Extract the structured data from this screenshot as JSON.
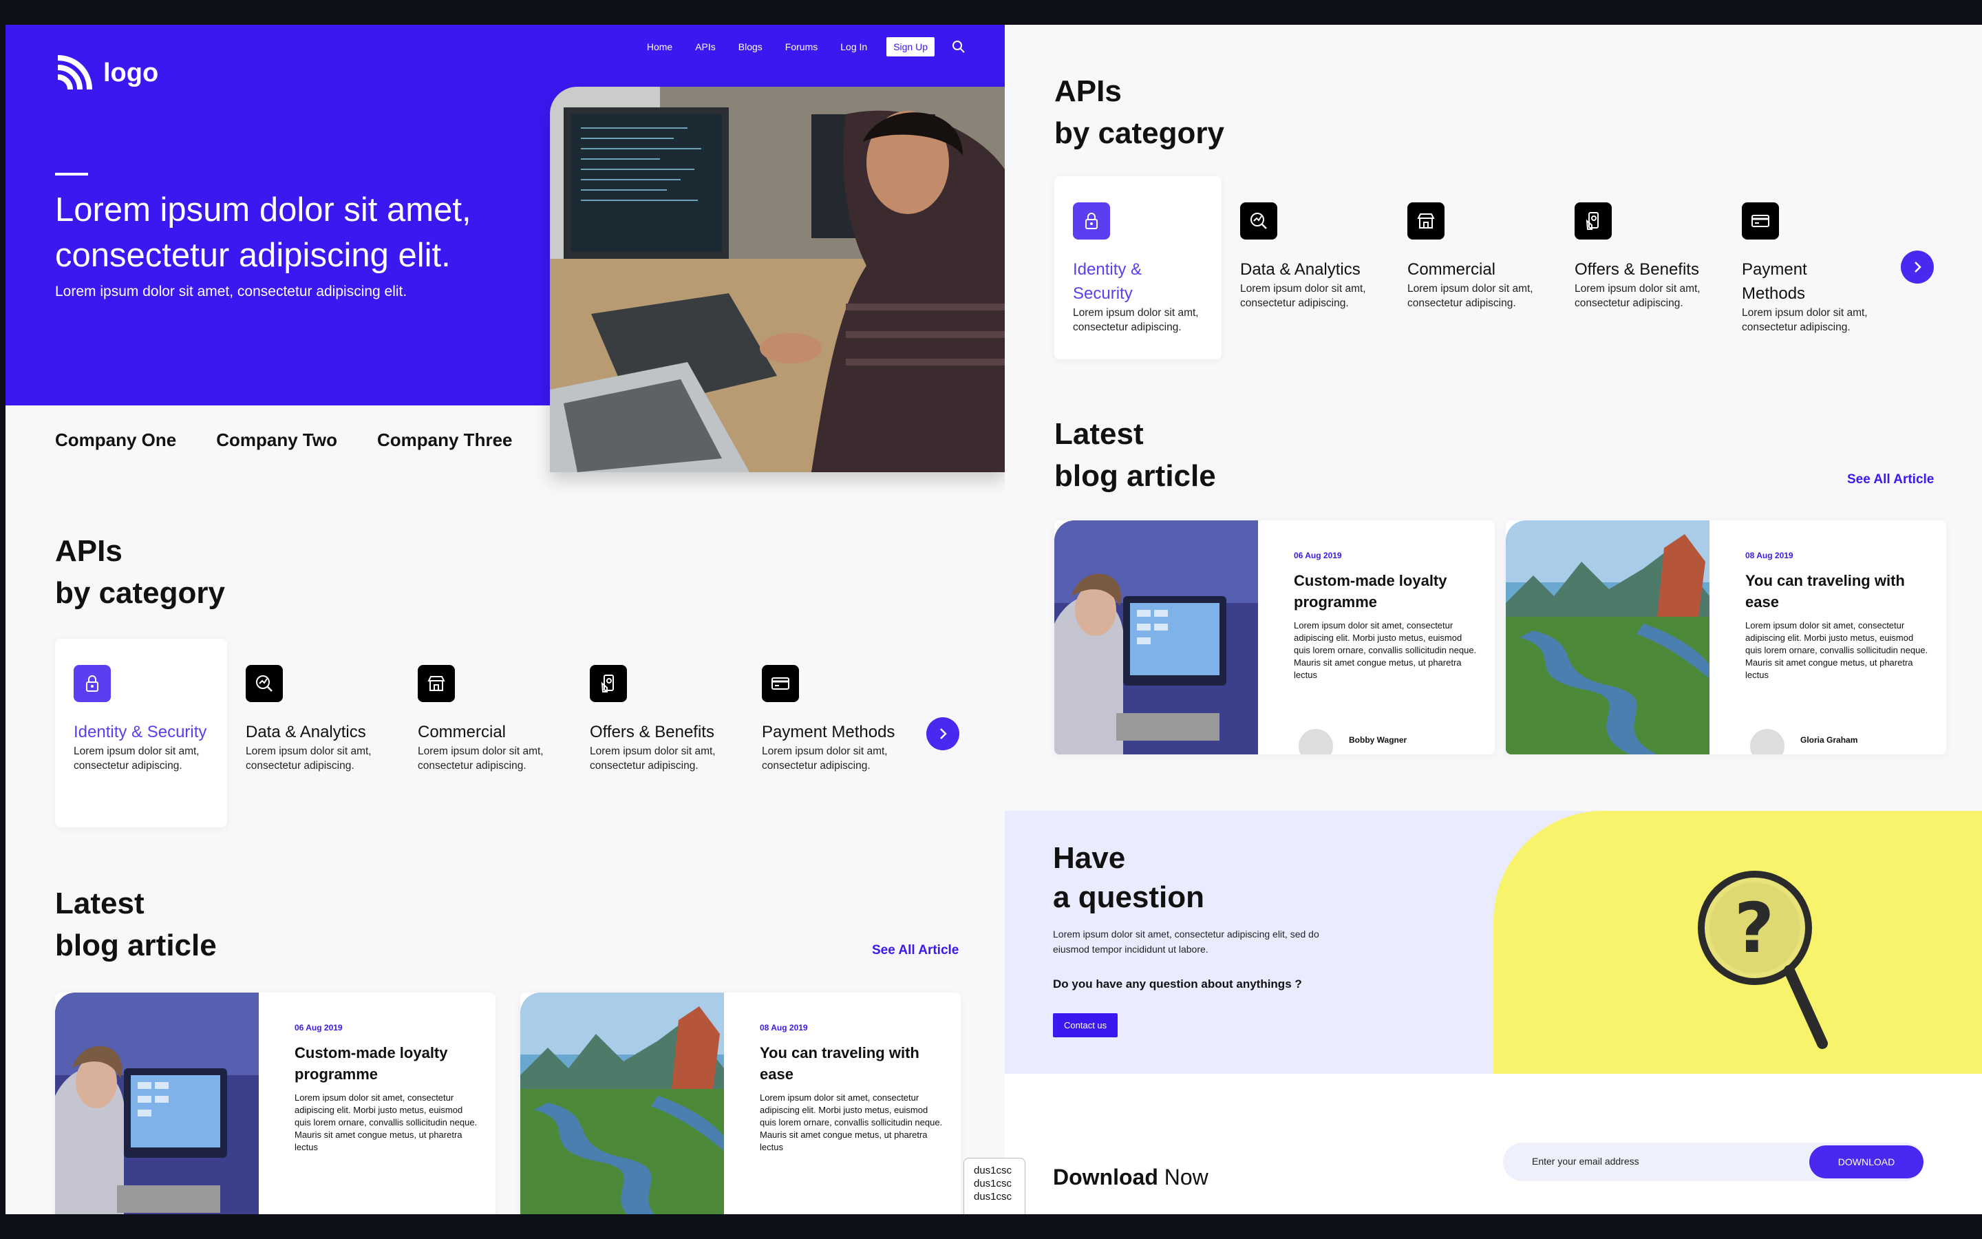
{
  "brand": {
    "logo_text": "logo"
  },
  "nav": {
    "items": [
      "Home",
      "APIs",
      "Blogs",
      "Forums",
      "Log In"
    ],
    "signup": "Sign Up"
  },
  "hero": {
    "title": "Lorem ipsum dolor sit amet, consectetur adipiscing elit.",
    "subtitle": "Lorem ipsum dolor sit amet, consectetur adipiscing elit."
  },
  "companies": [
    "Company One",
    "Company Two",
    "Company Three"
  ],
  "apis": {
    "title_line1": "APIs",
    "title_line2": "by category",
    "categories": [
      {
        "title": "Identity & Security",
        "desc": "Lorem ipsum dolor sit amt, consectetur adipiscing.",
        "icon": "lock-icon"
      },
      {
        "title": "Data & Analytics",
        "desc": "Lorem ipsum dolor sit amt, consectetur adipiscing.",
        "icon": "analytics-icon"
      },
      {
        "title": "Commercial",
        "desc": "Lorem ipsum dolor sit amt, consectetur adipiscing.",
        "icon": "store-icon"
      },
      {
        "title": "Offers & Benefits",
        "desc": "Lorem ipsum dolor sit amt, consectetur adipiscing.",
        "icon": "offers-icon"
      },
      {
        "title": "Payment Methods",
        "desc": "Lorem ipsum dolor sit amt, consectetur adipiscing.",
        "icon": "card-icon"
      }
    ]
  },
  "blog": {
    "title_line1": "Latest",
    "title_line2": "blog article",
    "see_all": "See All Article",
    "articles": [
      {
        "date": "06 Aug 2019",
        "title": "Custom-made loyalty programme",
        "body": "Lorem ipsum dolor sit amet, consectetur adipiscing elit. Morbi justo metus, euismod quis lorem ornare, convallis sollicitudin neque. Mauris sit amet congue metus, ut pharetra lectus",
        "author": "Bobby Wagner"
      },
      {
        "date": "08 Aug 2019",
        "title": "You can traveling with ease",
        "body": "Lorem ipsum dolor sit amet, consectetur adipiscing elit. Morbi justo metus, euismod quis lorem ornare, convallis sollicitudin neque. Mauris sit amet congue metus, ut pharetra lectus",
        "author": "Gloria Graham"
      }
    ]
  },
  "question": {
    "title_line1": "Have",
    "title_line2": "a question",
    "text": "Lorem ipsum dolor sit amet, consectetur adipiscing elit, sed do eiusmod tempor incididunt ut labore.",
    "ask": "Do you have any question about anythings ?",
    "contact": "Contact us"
  },
  "download": {
    "bold": "Download",
    "regular": " Now",
    "placeholder": "Enter your email address",
    "button": "DOWNLOAD"
  },
  "tooltip": [
    "dus1csc",
    "dus1csc",
    "dus1csc"
  ],
  "colors": {
    "brand": "#3a18ef",
    "accent": "#5a3ff0",
    "yellow": "#f7f36a"
  }
}
